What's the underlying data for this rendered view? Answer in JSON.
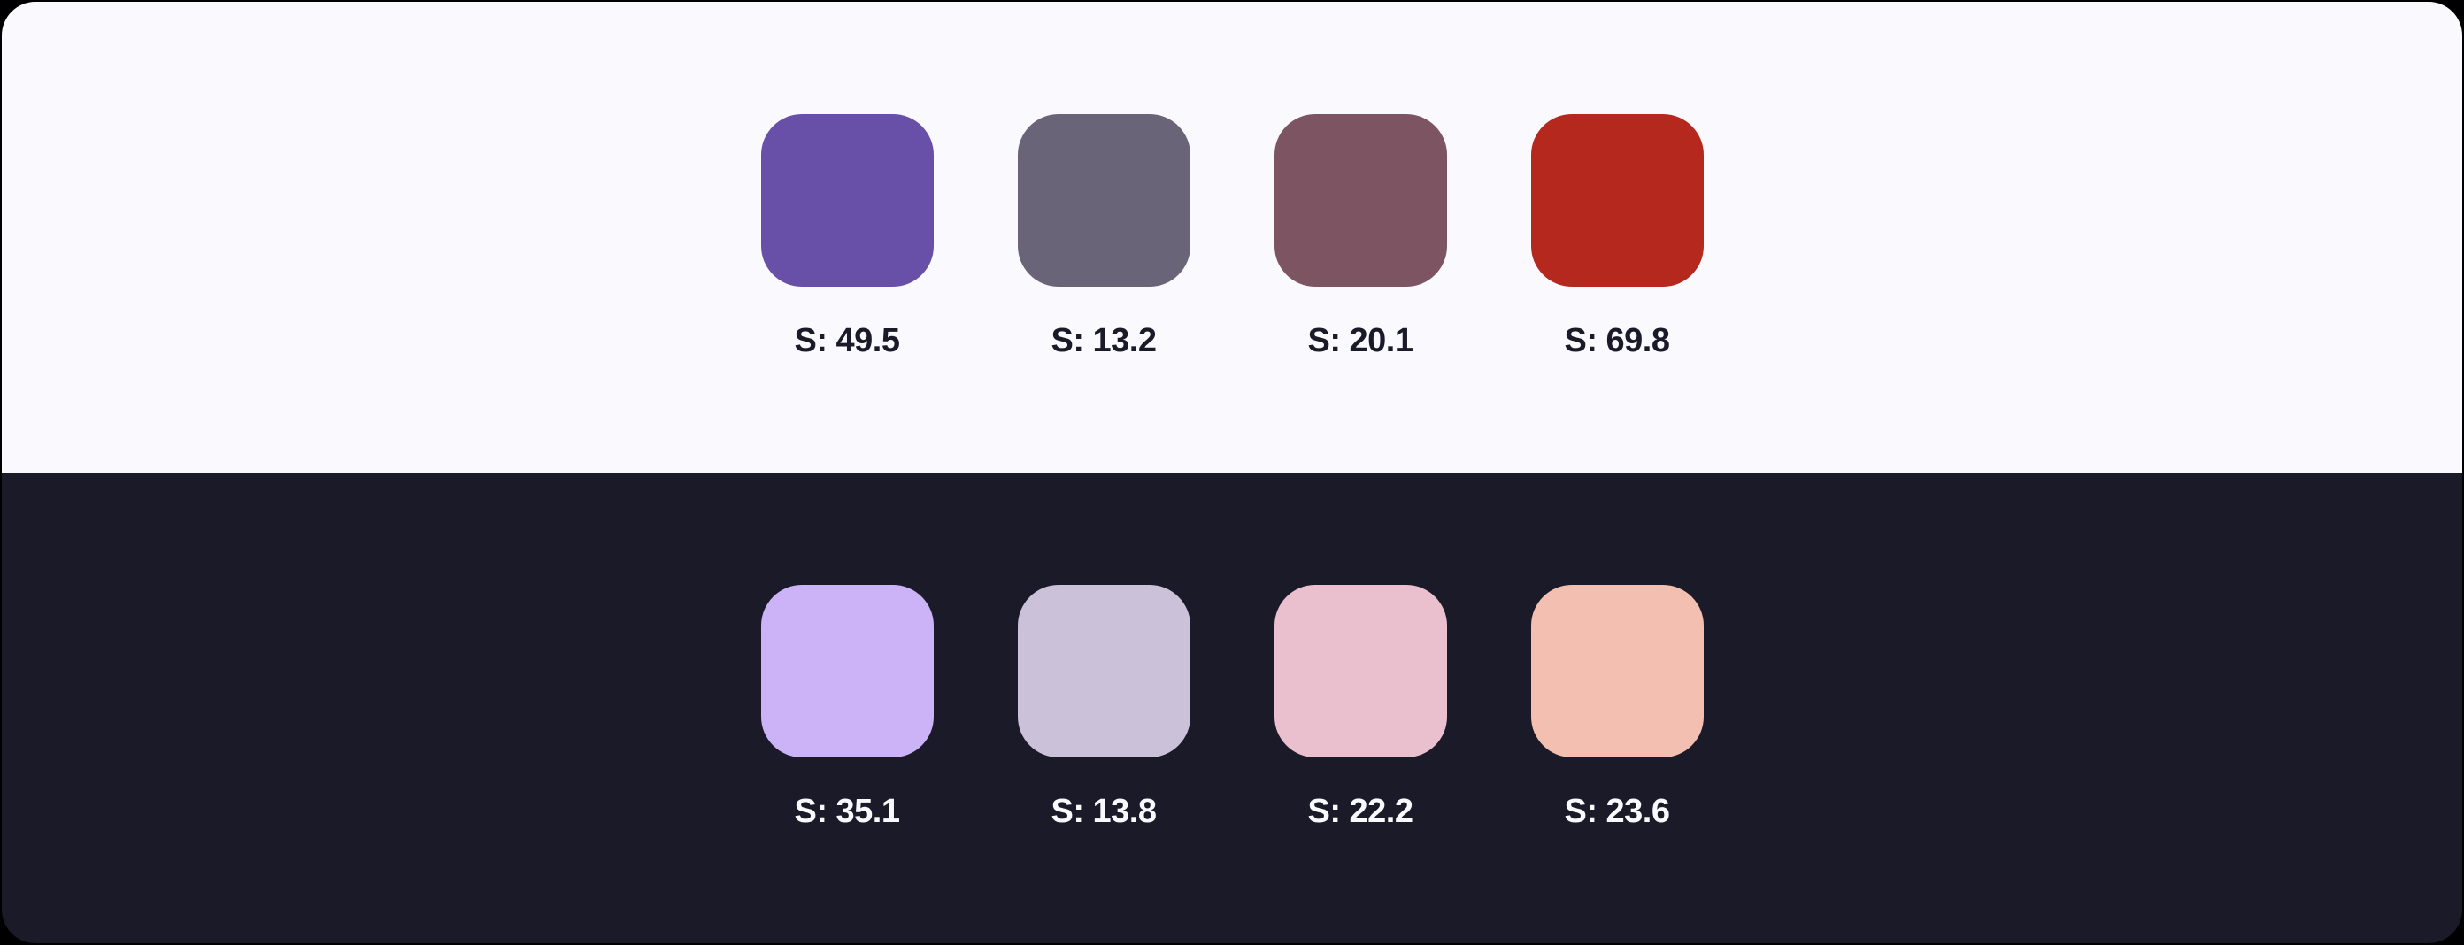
{
  "light_panel": {
    "background": "#faf9fe",
    "swatches": [
      {
        "color": "#6850a8",
        "label": "S: 49.5"
      },
      {
        "color": "#6a6478",
        "label": "S: 13.2"
      },
      {
        "color": "#7d5461",
        "label": "S: 20.1"
      },
      {
        "color": "#b4281d",
        "label": "S: 69.8"
      }
    ]
  },
  "dark_panel": {
    "background": "#1a1a29",
    "swatches": [
      {
        "color": "#ccb2f6",
        "label": "S: 35.1"
      },
      {
        "color": "#cbc1d8",
        "label": "S: 13.8"
      },
      {
        "color": "#eac0cf",
        "label": "S: 22.2"
      },
      {
        "color": "#f2bfb0",
        "label": "S: 23.6"
      }
    ]
  }
}
